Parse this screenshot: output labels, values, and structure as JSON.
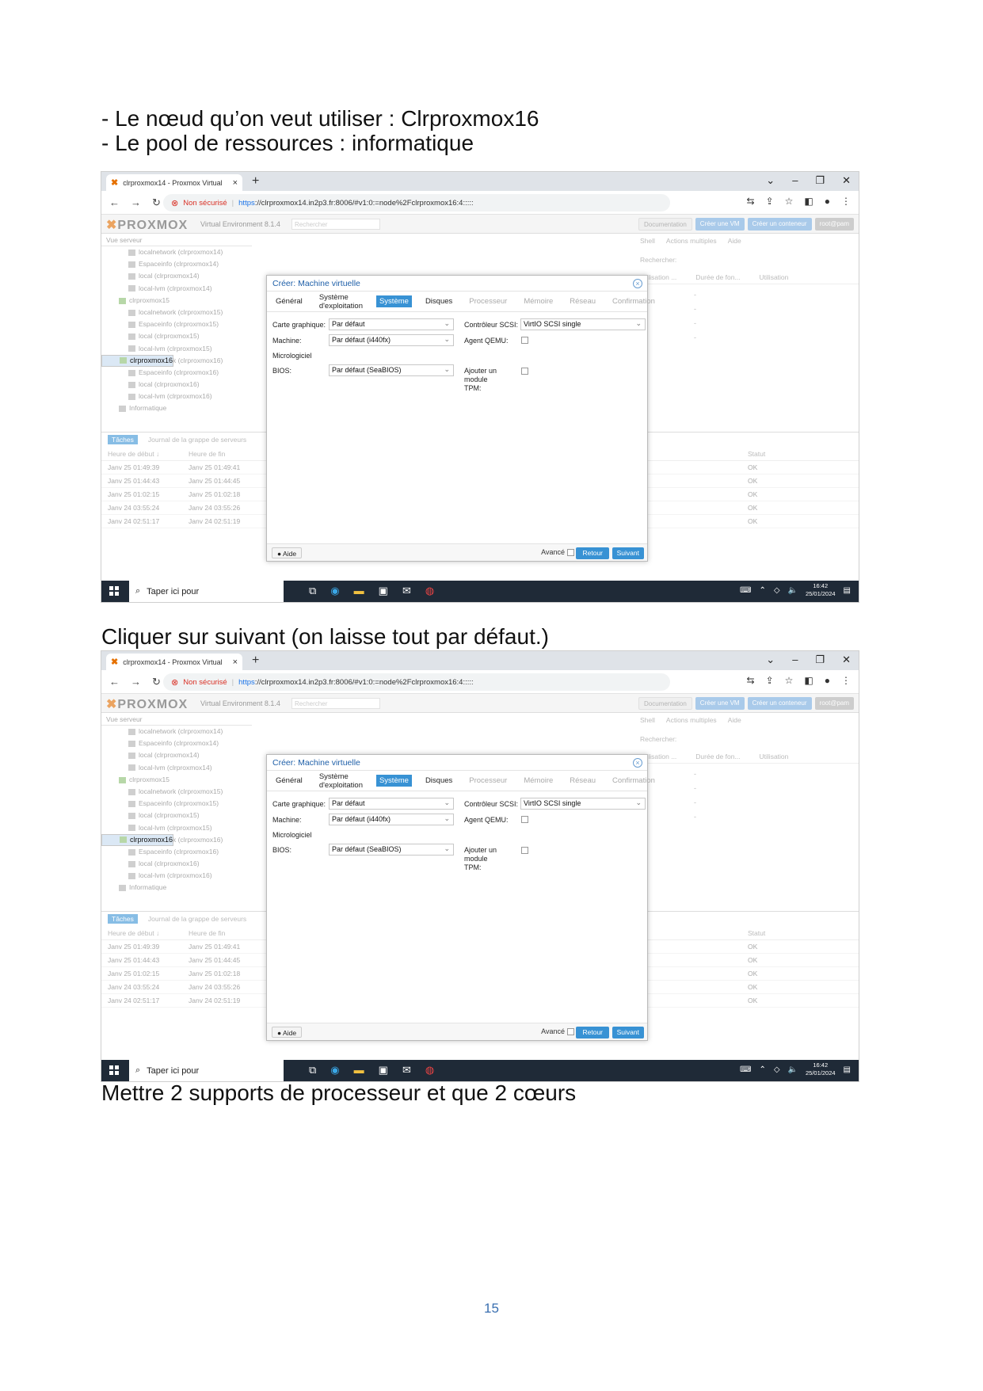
{
  "lines": {
    "node": "- Le nœud qu’on veut utiliser : Clrproxmox16",
    "pool": "- Le pool de ressources : informatique",
    "click": "Cliquer sur suivant (on laisse tout par défaut.)",
    "cpu": "Mettre 2 supports de processeur et que 2 cœurs"
  },
  "page_number": "15",
  "browser": {
    "tab_title": "clrproxmox14 - Proxmox Virtual",
    "new_tab": "+",
    "not_secure": "Non sécurisé",
    "url_https": "https",
    "url_rest": "://clrproxmox14.in2p3.fr:8006/#v1:0:=node%2Fclrproxmox16:4:::::",
    "win_min": "–",
    "win_max": "❐",
    "win_close": "✕"
  },
  "pve": {
    "logo": "PROXMOX",
    "version": "Virtual Environment 8.1.4",
    "search_placeholder": "Rechercher",
    "btn_doc": "Documentation",
    "btn_create_vm": "Créer une VM",
    "btn_create_ct": "Créer un conteneur",
    "btn_user": "root@pam",
    "tree_header": "Vue serveur",
    "tree": [
      {
        "label": "localnetwork (clrproxmox14)",
        "type": "storage"
      },
      {
        "label": "Espaceinfo (clrproxmox14)",
        "type": "storage"
      },
      {
        "label": "local (clrproxmox14)",
        "type": "storage"
      },
      {
        "label": "local-lvm (clrproxmox14)",
        "type": "storage"
      },
      {
        "label": "clrproxmox15",
        "type": "node"
      },
      {
        "label": "localnetwork (clrproxmox15)",
        "type": "storage"
      },
      {
        "label": "Espaceinfo (clrproxmox15)",
        "type": "storage"
      },
      {
        "label": "local (clrproxmox15)",
        "type": "storage"
      },
      {
        "label": "local-lvm (clrproxmox15)",
        "type": "storage"
      },
      {
        "label": "clrproxmox16",
        "type": "node"
      },
      {
        "label": "localnetwork (clrproxmox16)",
        "type": "storage"
      },
      {
        "label": "Espaceinfo (clrproxmox16)",
        "type": "storage"
      },
      {
        "label": "local (clrproxmox16)",
        "type": "storage"
      },
      {
        "label": "local-lvm (clrproxmox16)",
        "type": "storage"
      },
      {
        "label": "Informatique",
        "type": "pool"
      }
    ],
    "right": {
      "shell": "Shell",
      "bulk": "Actions multiples",
      "help": "Aide",
      "search": "Rechercher:",
      "col_usage": "Utilisation ...",
      "col_uptime": "Durée de fon...",
      "col_usage2": "Utilisation",
      "dash": "-"
    },
    "tasks": {
      "tab_tasks": "Tâches",
      "tab_log": "Journal de la grappe de serveurs",
      "col_start": "Heure de début ↓",
      "col_end": "Heure de fin",
      "col_status": "Statut",
      "rows": [
        {
          "start": "Janv 25 01:49:39",
          "end": "Janv 25 01:49:41",
          "status": "OK"
        },
        {
          "start": "Janv 25 01:44:43",
          "end": "Janv 25 01:44:45",
          "status": "OK"
        },
        {
          "start": "Janv 25 01:02:15",
          "end": "Janv 25 01:02:18",
          "status": "OK"
        },
        {
          "start": "Janv 24 03:55:24",
          "end": "Janv 24 03:55:26",
          "status": "OK"
        },
        {
          "start": "Janv 24 02:51:17",
          "end": "Janv 24 02:51:19",
          "status": "OK"
        }
      ]
    }
  },
  "dialog": {
    "title": "Créer: Machine virtuelle",
    "tabs": [
      {
        "label": "Général",
        "state": "normal"
      },
      {
        "label": "Système d'exploitation",
        "state": "normal"
      },
      {
        "label": "Système",
        "state": "active"
      },
      {
        "label": "Disques",
        "state": "normal"
      },
      {
        "label": "Processeur",
        "state": "disabled"
      },
      {
        "label": "Mémoire",
        "state": "disabled"
      },
      {
        "label": "Réseau",
        "state": "disabled"
      },
      {
        "label": "Confirmation",
        "state": "disabled"
      }
    ],
    "graphics_label": "Carte graphique:",
    "graphics_value": "Par défaut",
    "machine_label": "Machine:",
    "machine_value": "Par défaut (i440fx)",
    "firmware_label": "Micrologiciel",
    "bios_label": "BIOS:",
    "bios_value": "Par défaut (SeaBIOS)",
    "scsi_label": "Contrôleur SCSI:",
    "scsi_value": "VirtIO SCSI single",
    "qemu_label": "Agent QEMU:",
    "tpm_label": "Ajouter un module TPM:",
    "help": "Aide",
    "advanced": "Avancé",
    "back": "Retour",
    "next": "Suivant"
  },
  "taskbar": {
    "search": "Taper ici pour",
    "time": "16:42",
    "date": "25/01/2024"
  }
}
